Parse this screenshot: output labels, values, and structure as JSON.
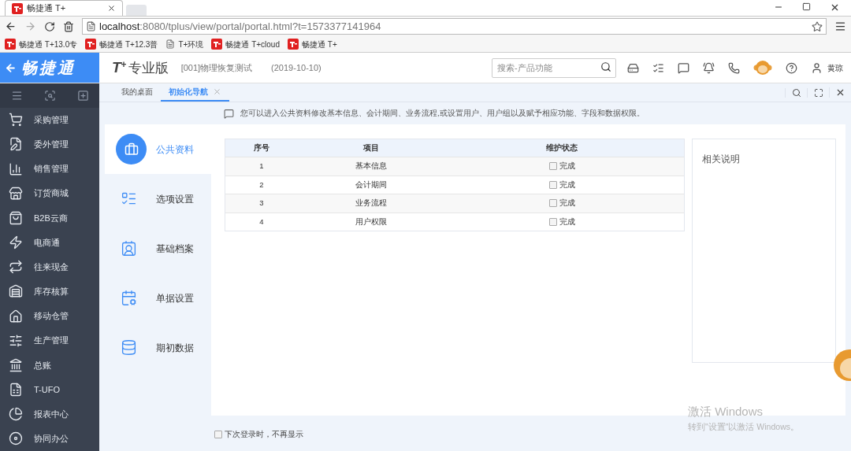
{
  "browser": {
    "tab": {
      "title": "畅捷通 T+"
    },
    "url": {
      "host": "localhost",
      "rest": ":8080/tplus/view/portal/portal.html?t=1573377141964"
    },
    "bookmarks": [
      {
        "label": "畅捷通 T+13.0专",
        "kind": "app"
      },
      {
        "label": "畅捷通 T+12.3普",
        "kind": "app"
      },
      {
        "label": "T+环境",
        "kind": "page"
      },
      {
        "label": "畅捷通 T+cloud",
        "kind": "app"
      },
      {
        "label": "畅捷通 T+",
        "kind": "app"
      }
    ]
  },
  "header": {
    "logo": "畅捷通",
    "brand": "T",
    "brand_sup": "+",
    "edition": "专业版",
    "account": "[001]物理恢复测试",
    "date": "(2019-10-10)",
    "search": {
      "placeholder": "搜索-产品功能"
    },
    "user": "黄琼"
  },
  "sidebar": {
    "items": [
      {
        "label": "采购管理"
      },
      {
        "label": "委外管理"
      },
      {
        "label": "销售管理"
      },
      {
        "label": "订货商城"
      },
      {
        "label": "B2B云商"
      },
      {
        "label": "电商通"
      },
      {
        "label": "往来现金"
      },
      {
        "label": "库存核算"
      },
      {
        "label": "移动仓管"
      },
      {
        "label": "生产管理"
      },
      {
        "label": "总账"
      },
      {
        "label": "T-UFO"
      },
      {
        "label": "报表中心"
      },
      {
        "label": "协同办公"
      }
    ]
  },
  "tabs": [
    {
      "label": "我的桌面",
      "selected": false,
      "closable": false
    },
    {
      "label": "初始化导航",
      "selected": true,
      "closable": true
    }
  ],
  "notice": "您可以进入公共资料修改基本信息、会计期间、业务流程,或设置用户、用户组以及赋予相应功能、字段和数据权限。",
  "nav": [
    {
      "label": "公共资料",
      "selected": true
    },
    {
      "label": "选项设置",
      "selected": false
    },
    {
      "label": "基础档案",
      "selected": false
    },
    {
      "label": "单据设置",
      "selected": false
    },
    {
      "label": "期初数据",
      "selected": false
    }
  ],
  "table": {
    "columns": [
      "序号",
      "项目",
      "维护状态"
    ],
    "rows": [
      {
        "no": "1",
        "item": "基本信息",
        "status": "完成",
        "checked": false
      },
      {
        "no": "2",
        "item": "会计期间",
        "status": "完成",
        "checked": false
      },
      {
        "no": "3",
        "item": "业务流程",
        "status": "完成",
        "checked": false
      },
      {
        "no": "4",
        "item": "用户权限",
        "status": "完成",
        "checked": false
      }
    ]
  },
  "help_panel": {
    "title": "相关说明"
  },
  "footer": {
    "label": "下次登录时，不再显示",
    "checked": false
  },
  "os_notice": {
    "title": "激活 Windows",
    "subtitle": "转到\"设置\"以激活 Windows。"
  }
}
